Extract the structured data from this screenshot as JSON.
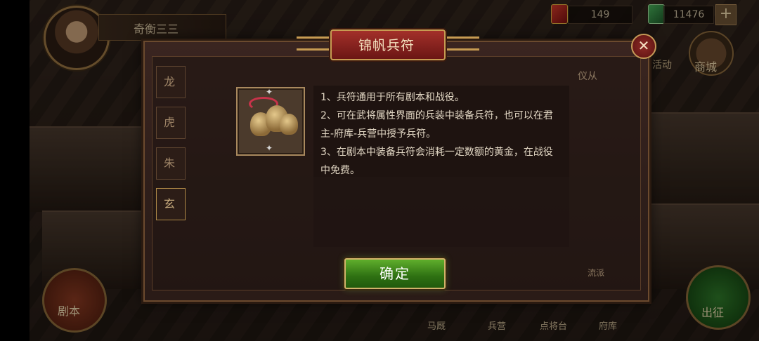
{
  "hud": {
    "player_name": "奇衡三三",
    "resource_1": "149",
    "resource_2": "11476",
    "plus": "+",
    "activity_label": "活动",
    "shop_label": "商城"
  },
  "side_tabs": [
    "龙",
    "虎",
    "朱",
    "玄"
  ],
  "behind": {
    "right_label": "仪从",
    "faction_label": "流派"
  },
  "bottom": {
    "script_label": "剧本",
    "expedition_label": "出征",
    "nav": [
      "马厩",
      "兵营",
      "点将台",
      "府库"
    ]
  },
  "dialog": {
    "title": "锦帆兵符",
    "close": "✕",
    "lines": [
      "1、兵符通用于所有剧本和战役。",
      "2、可在武将属性界面的兵装中装备兵符，也可以在君",
      "主-府库-兵营中授予兵符。",
      "3、在剧本中装备兵符会消耗一定数额的黄金，在战役",
      "中免费。"
    ],
    "confirm": "确定",
    "item_icon": "bells-icon"
  },
  "colors": {
    "dialog_title_bg": "#a3302a",
    "confirm_bg": "#2e7012",
    "border_gold": "#c79b52"
  }
}
